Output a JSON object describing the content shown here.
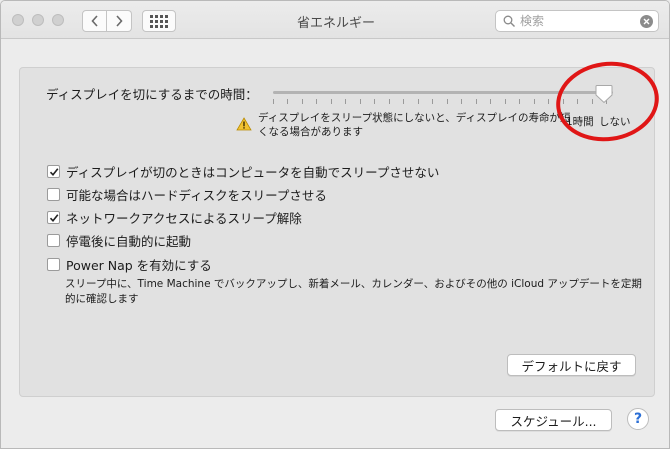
{
  "window": {
    "title": "省エネルギー"
  },
  "toolbar": {
    "back_icon": "chevron-left-icon",
    "forward_icon": "chevron-right-icon",
    "show_all_icon": "grid-icon"
  },
  "search": {
    "placeholder": "検索",
    "value": ""
  },
  "display_sleep": {
    "label": "ディスプレイを切にするまでの時間：",
    "value": "しない",
    "level_fraction": 1.0,
    "tick_labels": {
      "hour": "1時間",
      "never": "しない"
    },
    "warning": "ディスプレイをスリープ状態にしないと、ディスプレイの寿命が短くなる場合があります"
  },
  "options": [
    {
      "label": "ディスプレイが切のときはコンピュータを自動でスリープさせない",
      "checked": true
    },
    {
      "label": "可能な場合はハードディスクをスリープさせる",
      "checked": false
    },
    {
      "label": "ネットワークアクセスによるスリープ解除",
      "checked": true
    },
    {
      "label": "停電後に自動的に起動",
      "checked": false
    },
    {
      "label": "Power Nap を有効にする",
      "checked": false
    }
  ],
  "power_nap_description": "スリープ中に、Time Machine でバックアップし、新着メール、カレンダー、およびその他の iCloud アップデートを定期的に確認します",
  "buttons": {
    "restore_defaults": "デフォルトに戻す",
    "schedule": "スケジュール...",
    "help": "?"
  },
  "colors": {
    "annotation_circle": "#e01616",
    "help_accent": "#2b6fd6"
  }
}
